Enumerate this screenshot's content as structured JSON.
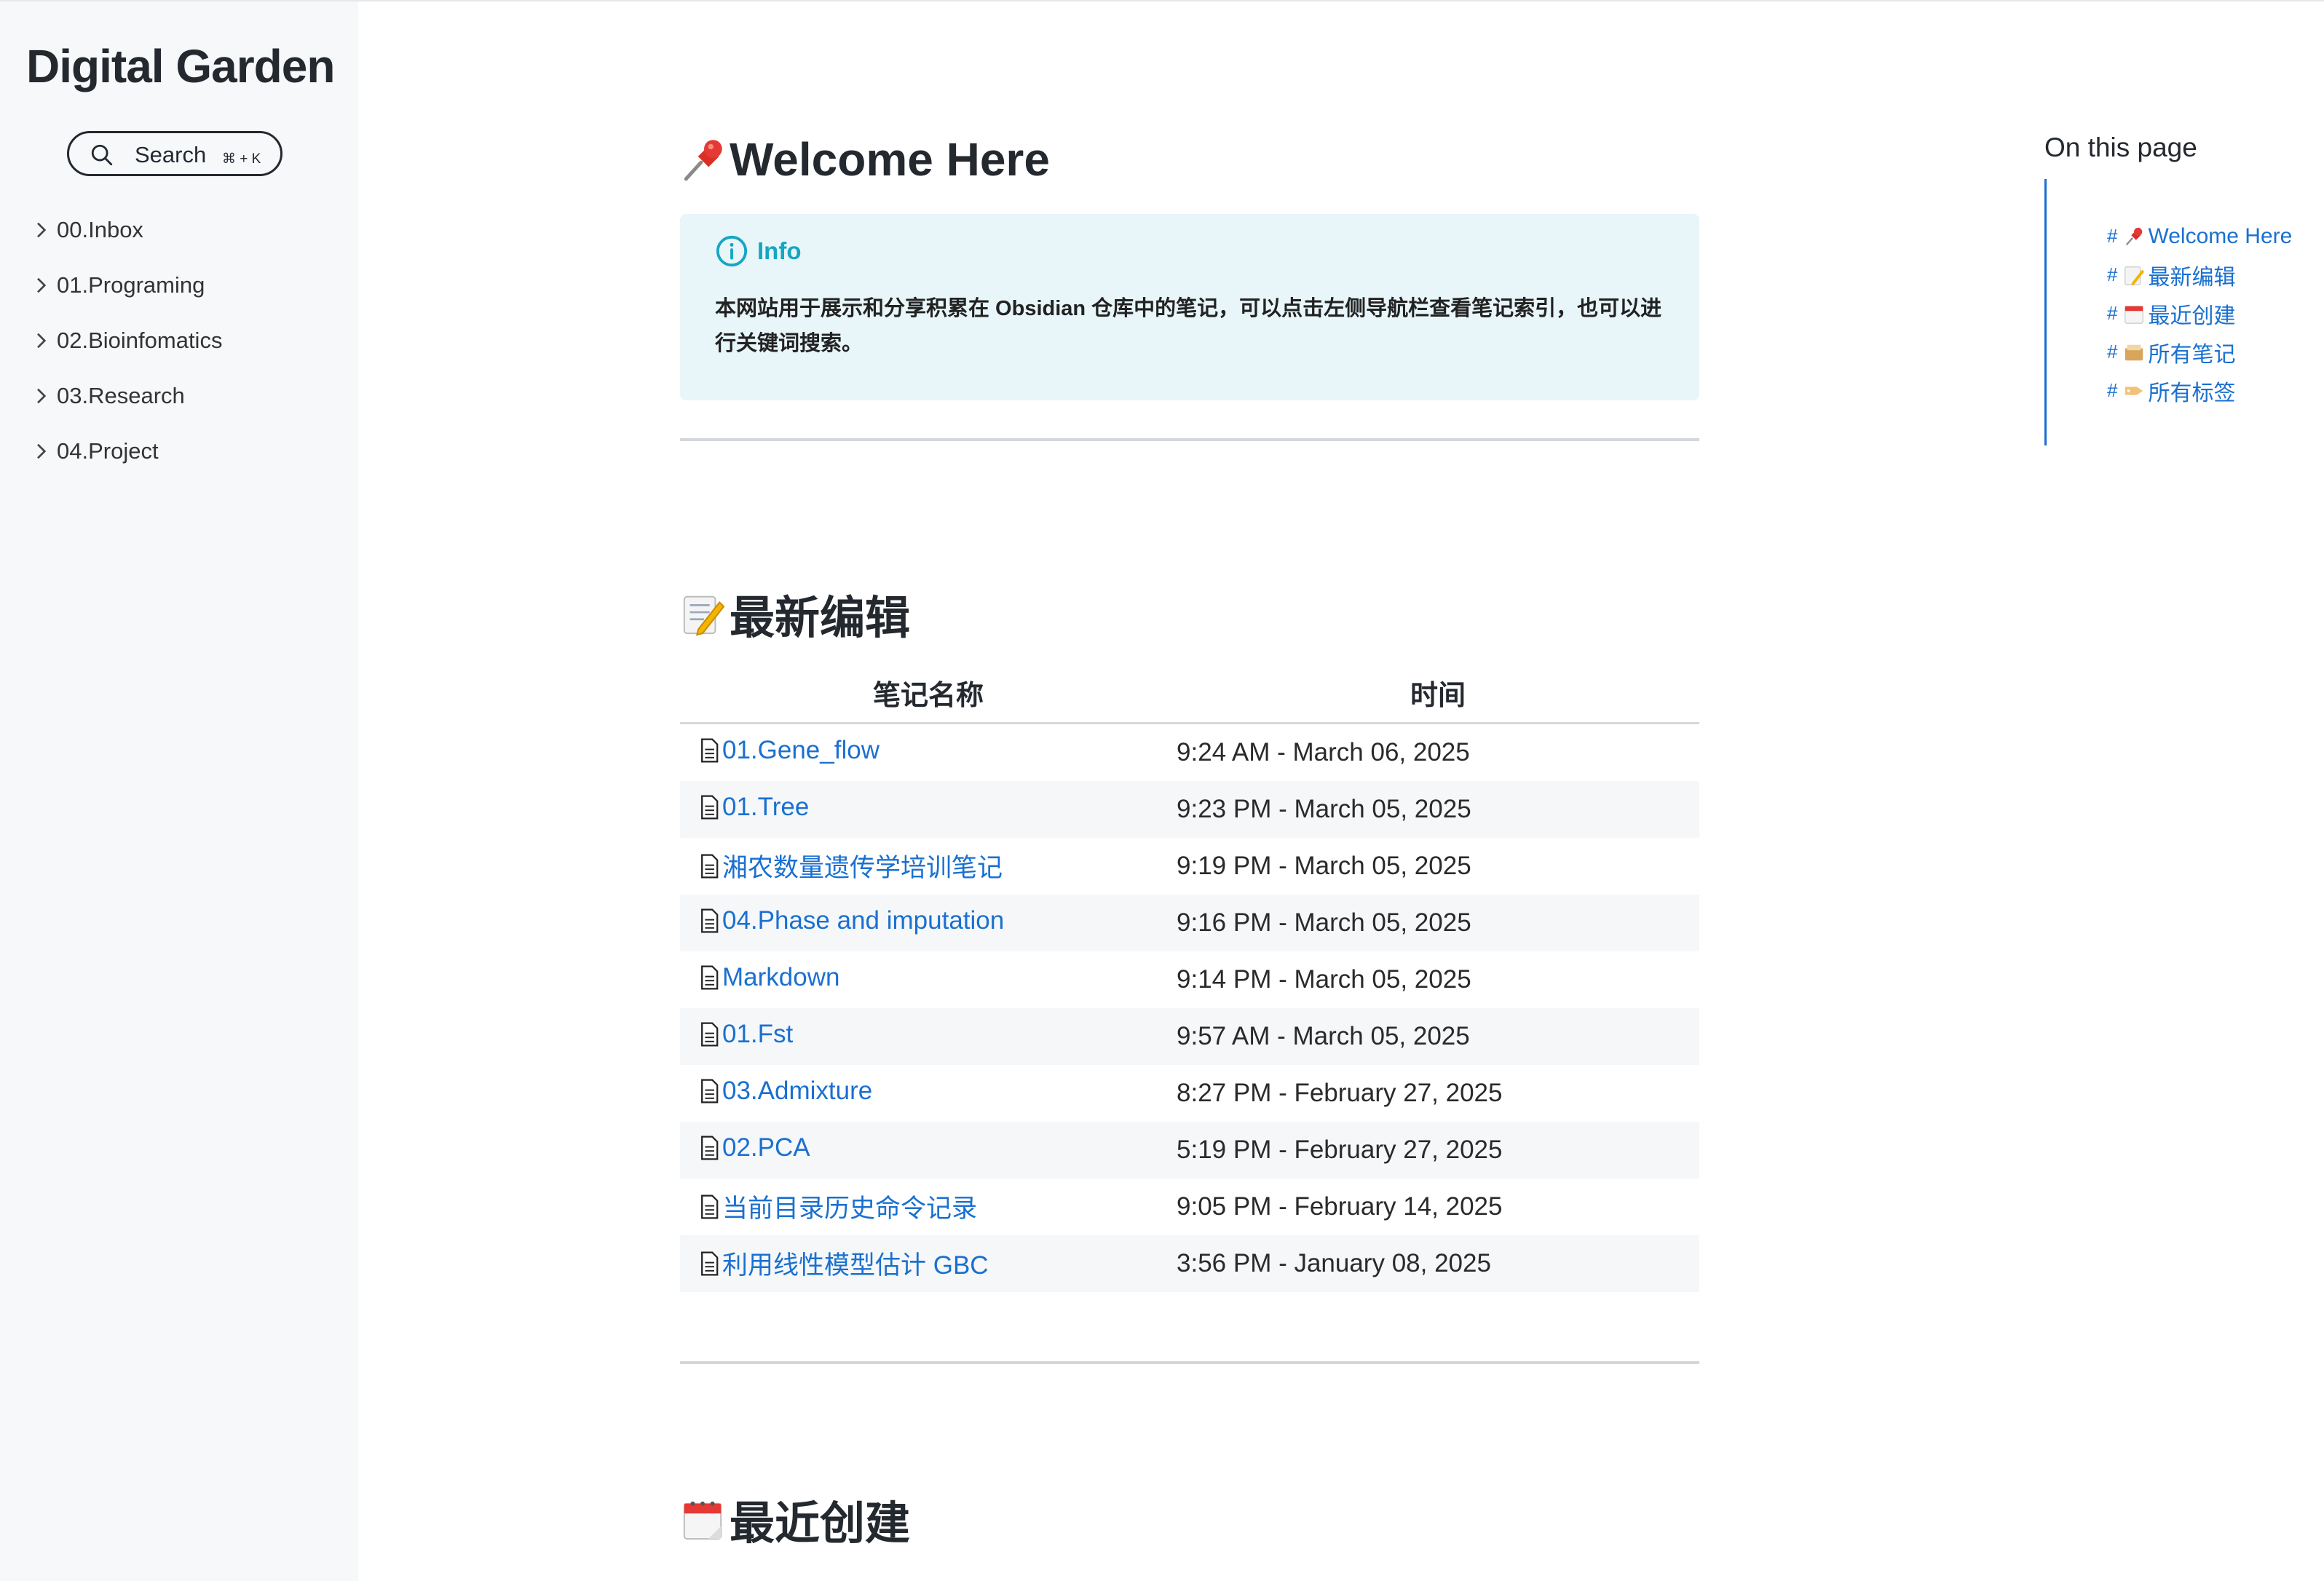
{
  "site": {
    "title": "Digital Garden"
  },
  "search": {
    "label": "Search",
    "shortcut": "⌘ + K"
  },
  "nav": [
    {
      "label": "00.Inbox"
    },
    {
      "label": "01.Programing"
    },
    {
      "label": "02.Bioinfomatics"
    },
    {
      "label": "03.Research"
    },
    {
      "label": "04.Project"
    }
  ],
  "page": {
    "title": "Welcome Here",
    "callout": {
      "title": "Info",
      "body": "本网站用于展示和分享积累在 Obsidian 仓库中的笔记，可以点击左侧导航栏查看笔记索引，也可以进行关键词搜索。"
    },
    "recent_edits": {
      "heading": "最新编辑",
      "columns": [
        "笔记名称",
        "时间"
      ],
      "rows": [
        {
          "name": "01.Gene_flow",
          "time": "9:24 AM - March 06, 2025"
        },
        {
          "name": "01.Tree",
          "time": "9:23 PM - March 05, 2025"
        },
        {
          "name": "湘农数量遗传学培训笔记",
          "time": "9:19 PM - March 05, 2025"
        },
        {
          "name": "04.Phase and imputation",
          "time": "9:16 PM - March 05, 2025"
        },
        {
          "name": "Markdown",
          "time": "9:14 PM - March 05, 2025"
        },
        {
          "name": "01.Fst",
          "time": "9:57 AM - March 05, 2025"
        },
        {
          "name": "03.Admixture",
          "time": "8:27 PM - February 27, 2025"
        },
        {
          "name": "02.PCA",
          "time": "5:19 PM - February 27, 2025"
        },
        {
          "name": "当前目录历史命令记录",
          "time": "9:05 PM - February 14, 2025"
        },
        {
          "name": "利用线性模型估计 GBC",
          "time": "3:56 PM - January 08, 2025"
        }
      ]
    },
    "recent_created": {
      "heading": "最近创建"
    }
  },
  "toc": {
    "title": "On this page",
    "items": [
      {
        "label": "Welcome Here",
        "icon": "pushpin-icon"
      },
      {
        "label": "最新编辑",
        "icon": "memo-icon"
      },
      {
        "label": "最近创建",
        "icon": "calendar-icon"
      },
      {
        "label": "所有笔记",
        "icon": "card-box-icon"
      },
      {
        "label": "所有标签",
        "icon": "tag-icon"
      }
    ]
  },
  "colors": {
    "link": "#1a70d0",
    "callout_bg": "#e8f6fa",
    "callout_accent": "#14a6c4",
    "sidebar_bg": "#f6f8fa"
  }
}
